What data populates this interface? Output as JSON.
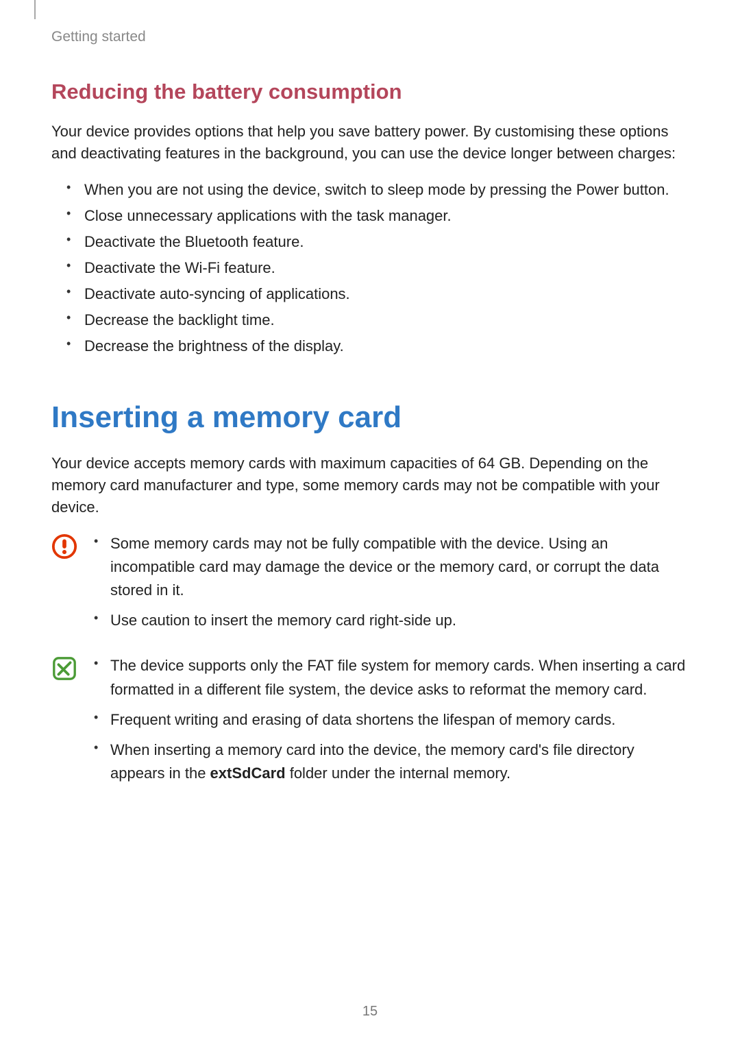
{
  "header": "Getting started",
  "subhead": "Reducing the battery consumption",
  "intro": "Your device provides options that help you save battery power. By customising these options and deactivating features in the background, you can use the device longer between charges:",
  "tips": [
    "When you are not using the device, switch to sleep mode by pressing the Power button.",
    "Close unnecessary applications with the task manager.",
    "Deactivate the Bluetooth feature.",
    "Deactivate the Wi-Fi feature.",
    "Deactivate auto-syncing of applications.",
    "Decrease the backlight time.",
    "Decrease the brightness of the display."
  ],
  "major_head": "Inserting a memory card",
  "memory_intro": "Your device accepts memory cards with maximum capacities of 64 GB. Depending on the memory card manufacturer and type, some memory cards may not be compatible with your device.",
  "warning": {
    "items": [
      "Some memory cards may not be fully compatible with the device. Using an incompatible card may damage the device or the memory card, or corrupt the data stored in it.",
      "Use caution to insert the memory card right-side up."
    ]
  },
  "note": {
    "items_pre": [
      "The device supports only the FAT file system for memory cards. When inserting a card formatted in a different file system, the device asks to reformat the memory card.",
      "Frequent writing and erasing of data shortens the lifespan of memory cards."
    ],
    "last_item_prefix": "When inserting a memory card into the device, the memory card's file directory appears in the ",
    "last_item_bold": "extSdCard",
    "last_item_suffix": " folder under the internal memory."
  },
  "page_number": "15"
}
